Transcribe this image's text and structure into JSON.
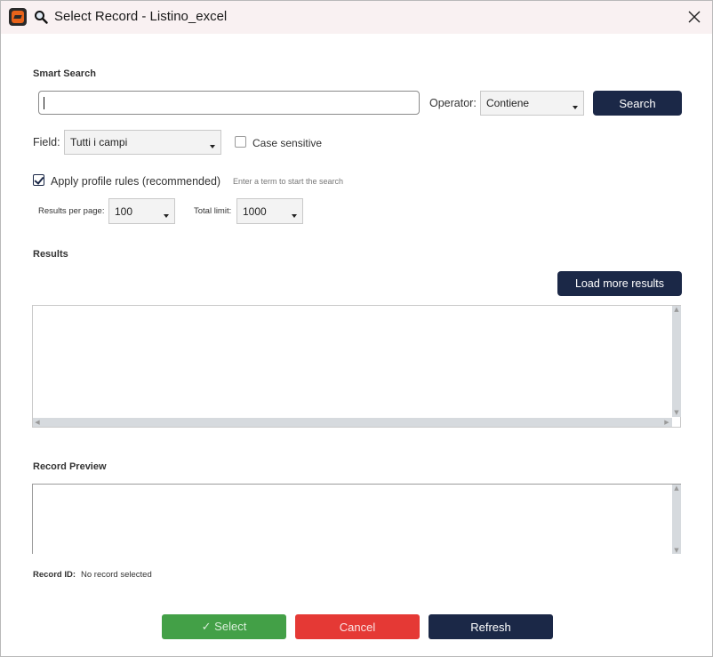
{
  "window": {
    "title": "Select Record - Listino_excel",
    "app_icon": "app-logo-icon",
    "title_icon": "magnifier-icon",
    "close_icon": "close-icon"
  },
  "smart_search": {
    "label": "Smart Search",
    "input_value": "",
    "operator_label": "Operator:",
    "operator_value": "Contiene",
    "search_button": "Search"
  },
  "field": {
    "label": "Field:",
    "value": "Tutti i campi",
    "case_sensitive_label": "Case sensitive",
    "case_sensitive_checked": false
  },
  "profile_rules": {
    "label": "Apply profile rules (recommended)",
    "checked": true,
    "hint": "Enter a term to start the search"
  },
  "paging": {
    "results_per_page_label": "Results per page:",
    "results_per_page_value": "100",
    "total_limit_label": "Total limit:",
    "total_limit_value": "1000"
  },
  "results": {
    "label": "Results",
    "load_more_button": "Load more results",
    "rows": []
  },
  "preview": {
    "label": "Record Preview",
    "content": ""
  },
  "record_id": {
    "label": "Record ID:",
    "value": "No record selected"
  },
  "footer": {
    "select_button": "✓ Select",
    "cancel_button": "Cancel",
    "refresh_button": "Refresh"
  },
  "colors": {
    "primary_dark": "#1b2847",
    "select_green": "#43a047",
    "cancel_red": "#e53935",
    "titlebar_bg": "#f9f1f2"
  }
}
